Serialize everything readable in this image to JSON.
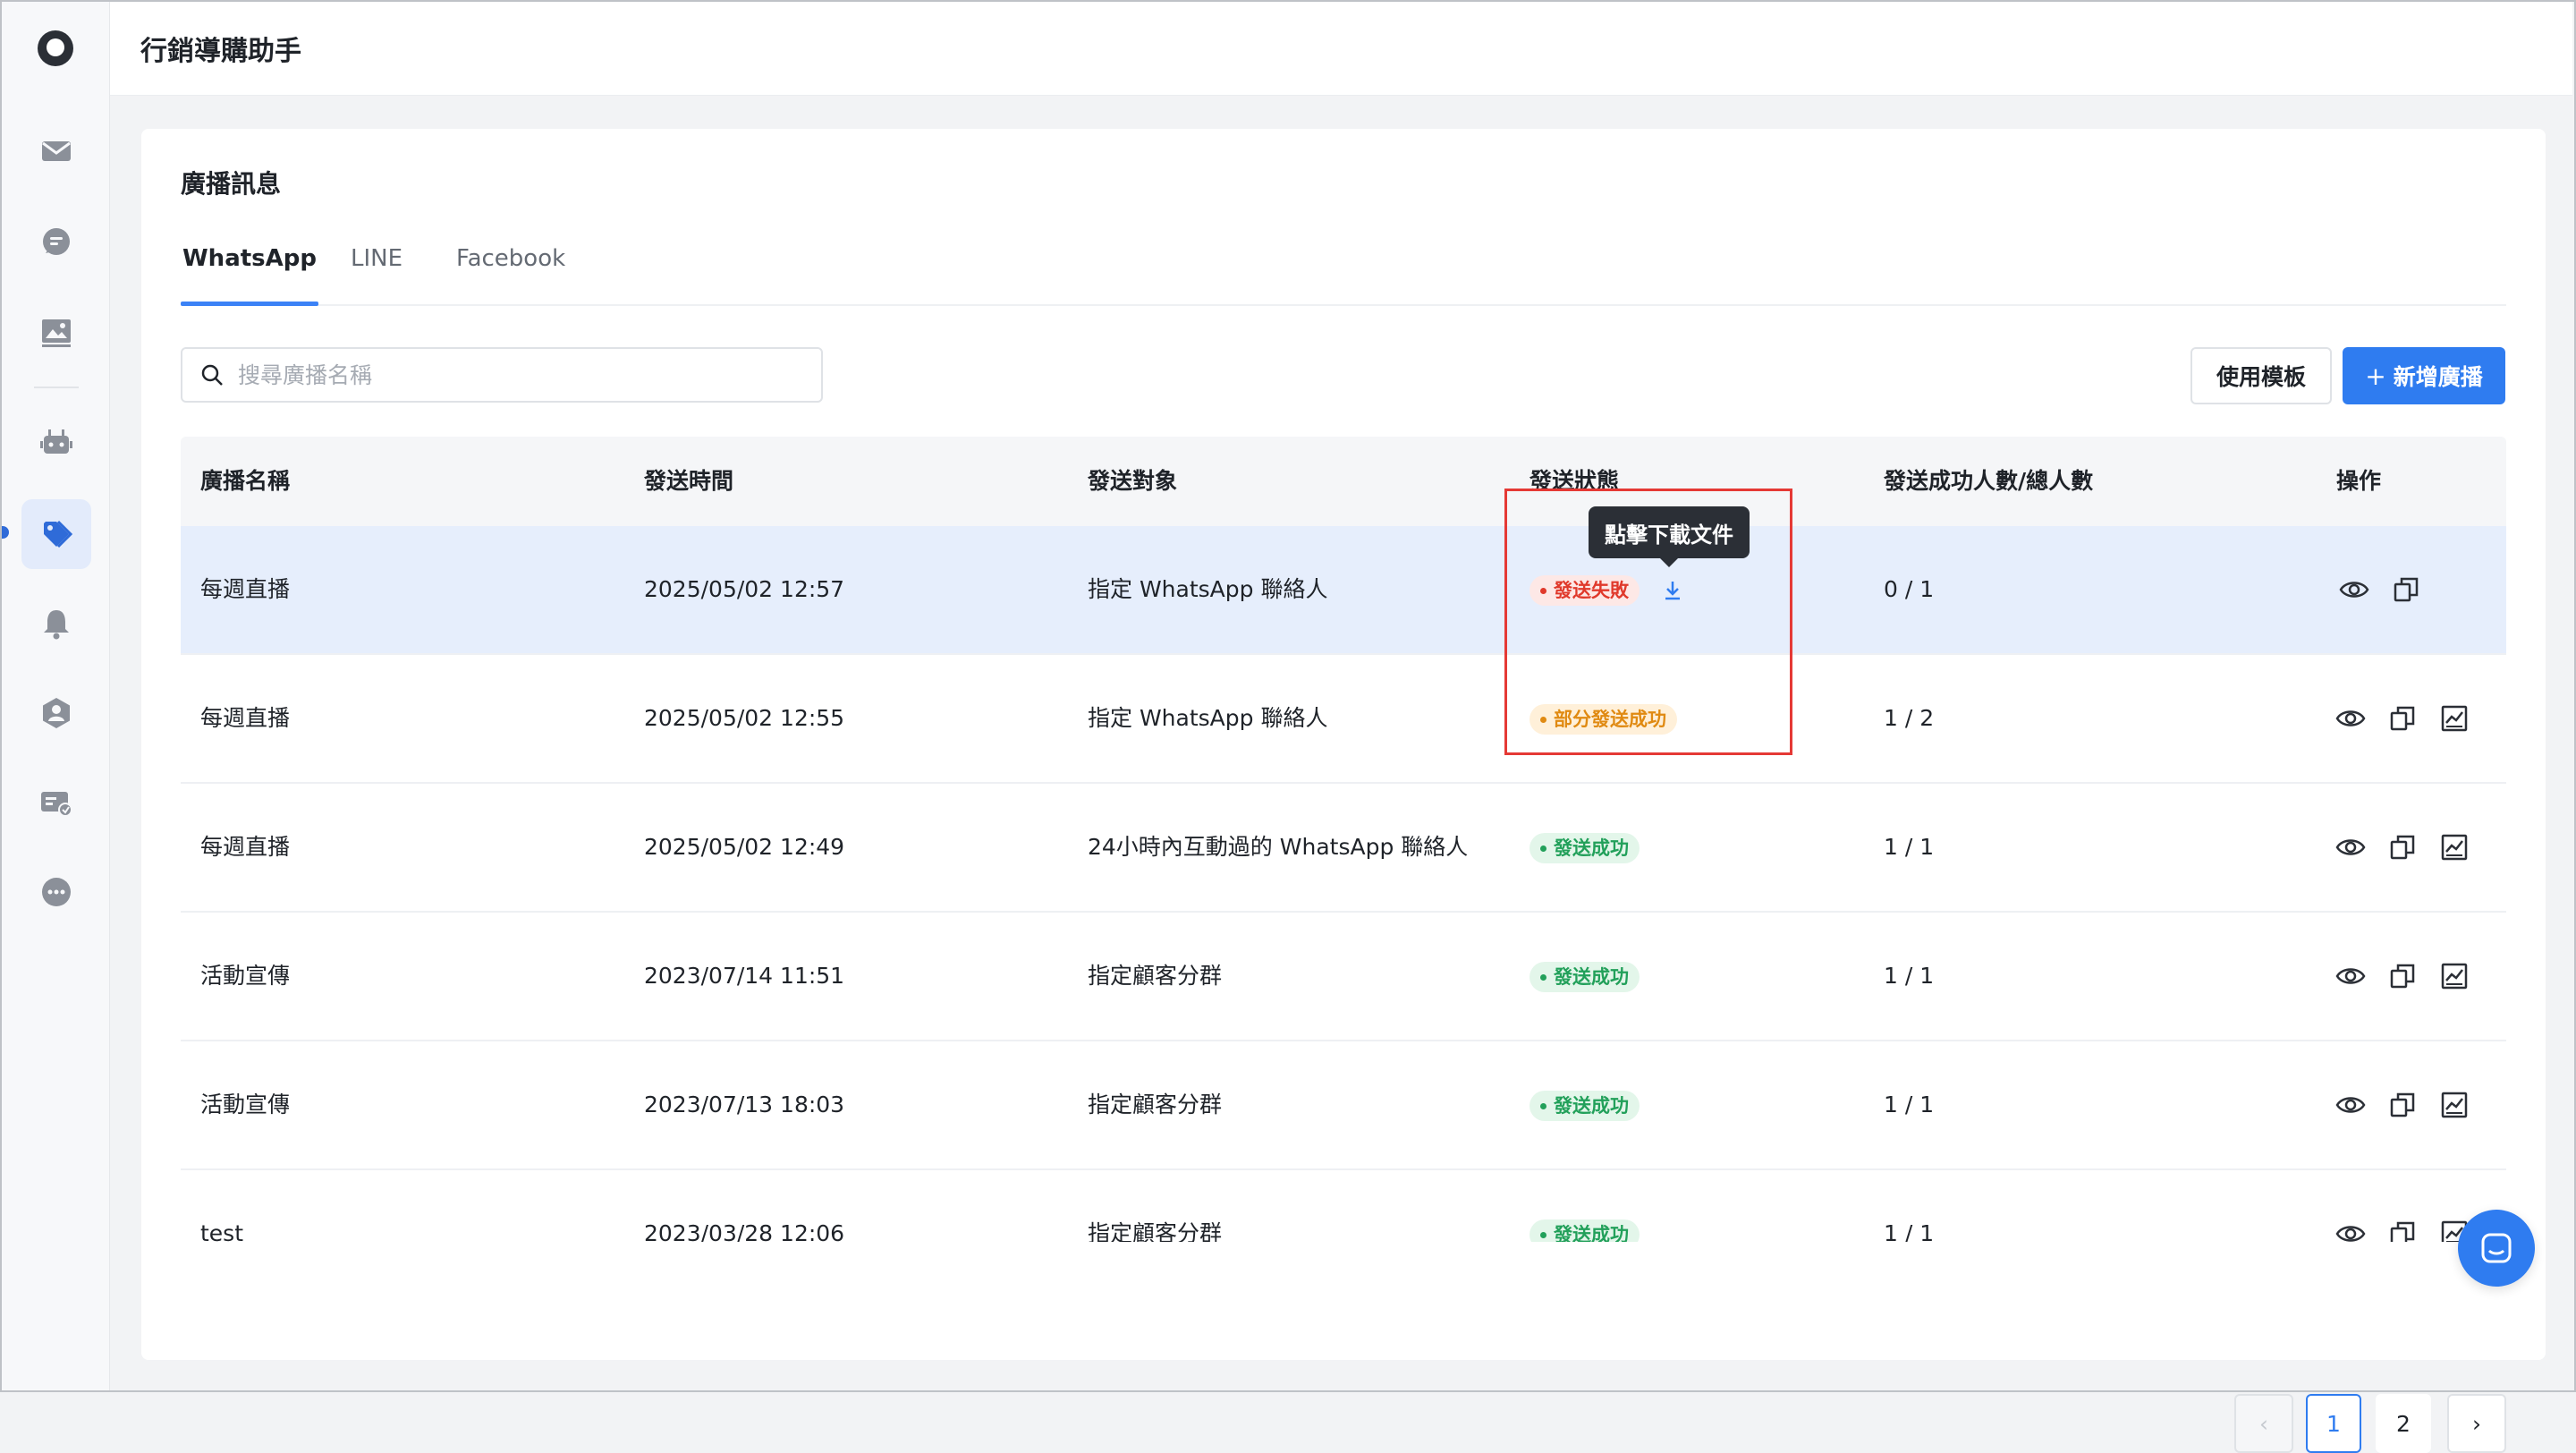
{
  "app": {
    "title": "行銷導購助手"
  },
  "page": {
    "title": "廣播訊息"
  },
  "tabs": [
    {
      "label": "WhatsApp",
      "active": true
    },
    {
      "label": "LINE",
      "active": false
    },
    {
      "label": "Facebook",
      "active": false
    }
  ],
  "search": {
    "placeholder": "搜尋廣播名稱",
    "value": ""
  },
  "toolbar": {
    "template_label": "使用模板",
    "new_label": "新增廣播",
    "new_icon": "+"
  },
  "table": {
    "headers": [
      "廣播名稱",
      "發送時間",
      "發送對象",
      "發送狀態",
      "發送成功人數/總人數",
      "操作"
    ],
    "rows": [
      {
        "name": "每週直播",
        "time": "2025/05/02 12:57",
        "target": "指定 WhatsApp 聯絡人",
        "status": "發送失敗",
        "status_type": "fail",
        "count": "0 / 1"
      },
      {
        "name": "每週直播",
        "time": "2025/05/02 12:55",
        "target": "指定 WhatsApp 聯絡人",
        "status": "部分發送成功",
        "status_type": "partial",
        "count": "1 / 2"
      },
      {
        "name": "每週直播",
        "time": "2025/05/02 12:49",
        "target": "24小時內互動過的 WhatsApp 聯絡人",
        "status": "發送成功",
        "status_type": "ok",
        "count": "1 / 1"
      },
      {
        "name": "活動宣傳",
        "time": "2023/07/14 11:51",
        "target": "指定顧客分群",
        "status": "發送成功",
        "status_type": "ok",
        "count": "1 / 1"
      },
      {
        "name": "活動宣傳",
        "time": "2023/07/13 18:03",
        "target": "指定顧客分群",
        "status": "發送成功",
        "status_type": "ok",
        "count": "1 / 1"
      },
      {
        "name": "test",
        "time": "2023/03/28 12:06",
        "target": "指定顧客分群",
        "status": "發送成功",
        "status_type": "ok",
        "count": "1 / 1"
      }
    ]
  },
  "tooltip": {
    "text": "點擊下載文件"
  },
  "pagination": {
    "prev": "‹",
    "pages": [
      "1",
      "2"
    ],
    "current": "1",
    "next": "›"
  },
  "colors": {
    "primary": "#2f7cf0",
    "fail": "#e0392b",
    "partial": "#e08a12",
    "success": "#22a05a",
    "highlight": "#e6eefc",
    "annotation": "#e53935"
  },
  "sidebar_icons": [
    "logo-icon",
    "mail-icon",
    "chat-bubble-icon",
    "image-icon",
    "robot-icon",
    "tag-icon",
    "bell-icon",
    "hexagon-user-icon",
    "ticket-icon",
    "more-icon"
  ]
}
